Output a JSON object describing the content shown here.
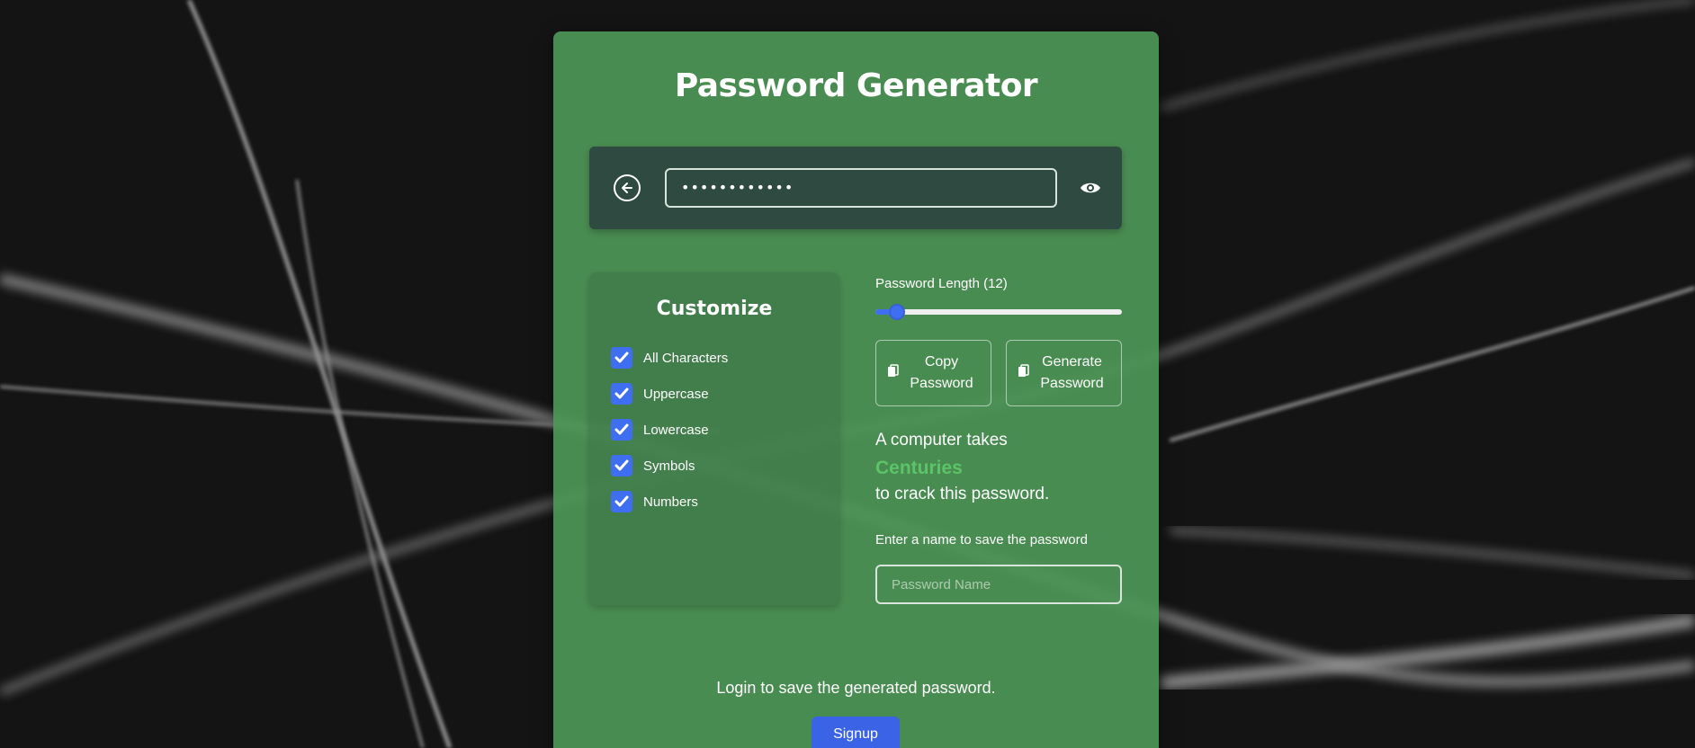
{
  "app": {
    "title": "Password Generator"
  },
  "password": {
    "masked_value": "••••••••••••",
    "length": 12,
    "visible": false
  },
  "customize": {
    "title": "Customize",
    "options": [
      {
        "label": "All Characters",
        "checked": true
      },
      {
        "label": "Uppercase",
        "checked": true
      },
      {
        "label": "Lowercase",
        "checked": true
      },
      {
        "label": "Symbols",
        "checked": true
      },
      {
        "label": "Numbers",
        "checked": true
      }
    ]
  },
  "length_control": {
    "label": "Password Length (12)",
    "value": 12,
    "fraction": 0.06
  },
  "buttons": {
    "copy_line1": "Copy",
    "copy_line2": "Password",
    "generate_line1": "Generate",
    "generate_line2": "Password"
  },
  "strength": {
    "line1": "A computer takes",
    "time": "Centuries",
    "line3": "to crack this password."
  },
  "save": {
    "label": "Enter a name to save the password",
    "placeholder": "Password Name"
  },
  "footer": {
    "login_text": "Login to save the generated password.",
    "signup_label": "Signup"
  },
  "colors": {
    "card": "#4e9656",
    "accent": "#3f6ef0",
    "strength": "#5cc468",
    "input_bar": "#2f4a40"
  }
}
